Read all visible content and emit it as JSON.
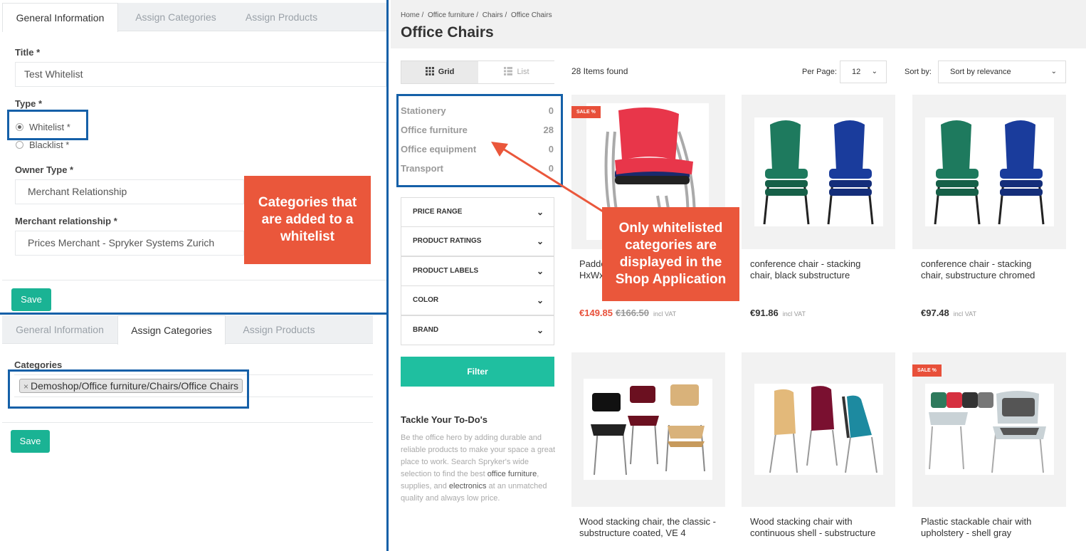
{
  "admin_top": {
    "tabs": [
      "General Information",
      "Assign Categories",
      "Assign Products"
    ],
    "title_label": "Title *",
    "title_value": "Test Whitelist",
    "type_label": "Type *",
    "type_options": [
      "Whitelist *",
      "Blacklist *"
    ],
    "type_selected": "Whitelist *",
    "owner_type_label": "Owner Type *",
    "owner_type_value": "Merchant Relationship",
    "merchant_rel_label": "Merchant relationship *",
    "merchant_rel_value": "Prices Merchant - Spryker Systems Zurich",
    "save_label": "Save"
  },
  "admin_bottom": {
    "tabs": [
      "General Information",
      "Assign Categories",
      "Assign Products"
    ],
    "categories_label": "Categories",
    "category_chip": "Demoshop/Office furniture/Chairs/Office Chairs",
    "chip_remove": "×",
    "save_label": "Save"
  },
  "callouts": {
    "left": "Categories that are added to a whitelist",
    "right": "Only whitelisted categories are displayed in the Shop Application"
  },
  "shop": {
    "breadcrumb": [
      "Home /",
      "Office furniture /",
      "Chairs /",
      "Office Chairs"
    ],
    "page_title": "Office Chairs",
    "view_grid": "Grid",
    "view_list": "List",
    "items_found": "28 Items found",
    "per_page_label": "Per Page:",
    "per_page_value": "12",
    "sort_label": "Sort by:",
    "sort_value": "Sort by relevance",
    "categories": [
      {
        "name": "Stationery",
        "count": "0"
      },
      {
        "name": "Office furniture",
        "count": "28"
      },
      {
        "name": "Office equipment",
        "count": "0"
      },
      {
        "name": "Transport",
        "count": "0"
      }
    ],
    "filters": [
      "PRICE RANGE",
      "PRODUCT RATINGS",
      "PRODUCT LABELS",
      "COLOR",
      "BRAND"
    ],
    "filter_button": "Filter",
    "todo_title": "Tackle Your To-Do's",
    "todo_text_1": "Be the office hero by adding durable and reliable products to make your space a great place to work. Search Spryker's wide selection to find the best ",
    "todo_link_1": "office furniture",
    "todo_text_2": ", supplies, and ",
    "todo_link_2": "electronics",
    "todo_text_3": " at an unmatched quality and always low price.",
    "sale_badge": "SALE %",
    "products": [
      {
        "title": "Padded HxWx",
        "price": "€149.85",
        "old_price": "€166.50",
        "vat": "incl VAT",
        "sale": true
      },
      {
        "title": "conference chair - stacking chair, black substructure",
        "price": "€91.86",
        "vat": "incl VAT",
        "sale": false
      },
      {
        "title": "conference chair - stacking chair, substructure chromed",
        "price": "€97.48",
        "vat": "incl VAT",
        "sale": false
      },
      {
        "title": "Wood stacking chair, the classic - substructure coated, VE 4",
        "sale": false
      },
      {
        "title": "Wood stacking chair with continuous shell - substructure",
        "sale": false
      },
      {
        "title": "Plastic stackable chair with upholstery - shell gray",
        "sale": true
      }
    ]
  },
  "colors": {
    "accent_green": "#1ab394",
    "highlight_blue": "#1560a8",
    "callout_red": "#ea573b",
    "sale_red": "#e8503a"
  }
}
